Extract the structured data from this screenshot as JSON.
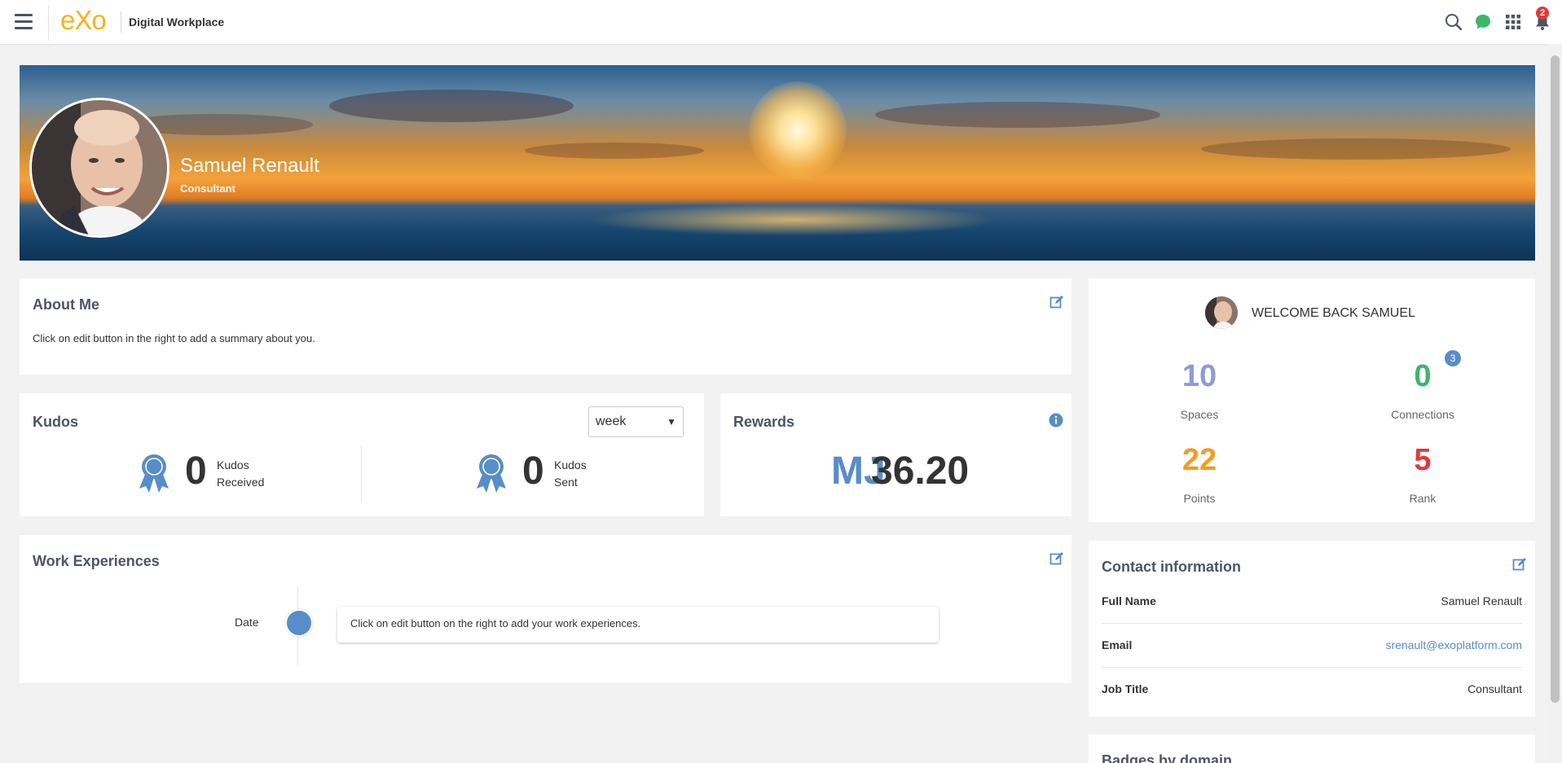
{
  "topbar": {
    "logo": "eXo",
    "app_title": "Digital Workplace",
    "notification_count": "2",
    "icons": [
      "menu-icon",
      "search-icon",
      "chat-icon",
      "apps-grid-icon",
      "bell-icon"
    ]
  },
  "profile": {
    "name": "Samuel Renault",
    "position": "Consultant"
  },
  "about": {
    "title": "About Me",
    "summary": "Click on edit button in the right to add a summary about you."
  },
  "kudos": {
    "title": "Kudos",
    "period": "week",
    "received_count": "0",
    "received_label_1": "Kudos",
    "received_label_2": "Received",
    "sent_count": "0",
    "sent_label_1": "Kudos",
    "sent_label_2": "Sent"
  },
  "rewards": {
    "title": "Rewards",
    "currency_symbol": "MJ",
    "amount": "36.20"
  },
  "work": {
    "title": "Work Experiences",
    "date_label": "Date",
    "empty_text": "Click on edit button on the right to add your work experiences."
  },
  "welcome": {
    "greeting": "WELCOME BACK SAMUEL",
    "stats": [
      {
        "value": "10",
        "label": "Spaces",
        "color": "#8f9bd6"
      },
      {
        "value": "0",
        "label": "Connections",
        "color": "#3fb56b",
        "badge": "3"
      },
      {
        "value": "22",
        "label": "Points",
        "color": "#f39c1f"
      },
      {
        "value": "5",
        "label": "Rank",
        "color": "#e03b3b"
      }
    ]
  },
  "contact": {
    "title": "Contact information",
    "full_name_label": "Full Name",
    "full_name": "Samuel Renault",
    "email_label": "Email",
    "email": "srenault@exoplatform.com",
    "job_label": "Job Title",
    "job": "Consultant"
  },
  "badges": {
    "title": "Badges by domain"
  },
  "colors": {
    "accent": "#578dc9",
    "title": "#4d5466",
    "link": "#578dc9"
  }
}
